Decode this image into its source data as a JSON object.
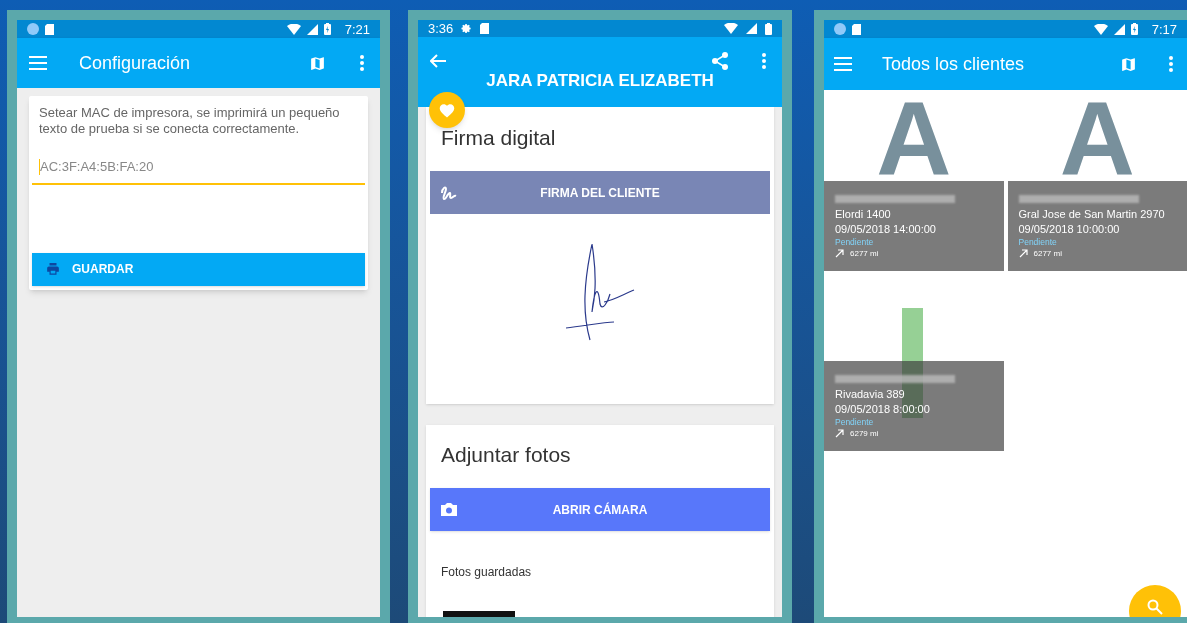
{
  "settings_screen": {
    "status_bar": {
      "time": "7:21"
    },
    "app_bar": {
      "title": "Configuración"
    },
    "description": "Setear MAC de impresora, se imprimirá un pequeño texto de prueba si se conecta correctamente.",
    "mac_field": {
      "value": "AC:3F:A4:5B:FA:20",
      "focused": true
    },
    "save_button": {
      "label": "GUARDAR"
    }
  },
  "client_screen": {
    "status_bar": {
      "time": "3:36"
    },
    "app_bar": {
      "title": "JARA PATRICIA ELIZABETH"
    },
    "signature_card": {
      "title": "Firma digital",
      "button": "FIRMA DEL CLIENTE"
    },
    "photos_card": {
      "title": "Adjuntar fotos",
      "button": "ABRIR CÁMARA",
      "saved_label": "Fotos guardadas"
    }
  },
  "clients_screen": {
    "status_bar": {
      "time": "7:17"
    },
    "app_bar": {
      "title": "Todos los clientes"
    },
    "tiles": [
      {
        "kind": "letter",
        "letter": "A",
        "address": "Elordi 1400",
        "datetime": "09/05/2018 14:00:00",
        "status": "Pendiente",
        "distance": "6277 mi"
      },
      {
        "kind": "letter",
        "letter": "A",
        "address": "Gral Jose de San Martin 2970",
        "datetime": "09/05/2018 10:00:00",
        "status": "Pendiente",
        "distance": "6277 mi"
      },
      {
        "kind": "bar",
        "address": "Rivadavia 389",
        "datetime": "09/05/2018 8:00:00",
        "status": "Pendiente",
        "distance": "6279 mi"
      }
    ]
  }
}
